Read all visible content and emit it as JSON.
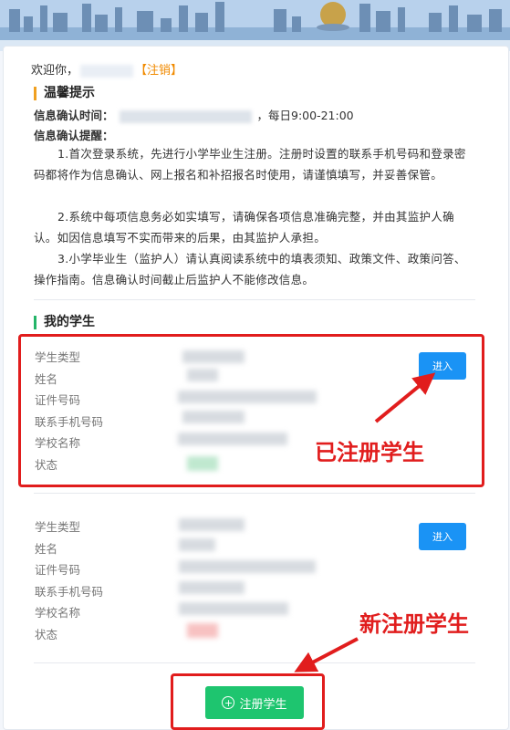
{
  "welcome": {
    "prefix": "欢迎你，",
    "logout_open": "【",
    "logout": "注销",
    "logout_close": "】"
  },
  "tips": {
    "title": "温馨提示",
    "time_label": "信息确认时间：",
    "time_suffix": "，每日9:00-21:00",
    "remind_label": "信息确认提醒：",
    "items": [
      "1.首次登录系统，先进行小学毕业生注册。注册时设置的联系手机号码和登录密码都将作为信息确认、网上报名和补招报名时使用，请谨慎填写，并妥善保管。",
      "2.系统中每项信息务必如实填写，请确保各项信息准确完整，并由其监护人确认。如因信息填写不实而带来的后果，由其监护人承担。",
      "3.小学毕业生（监护人）请认真阅读系统中的填表须知、政策文件、政策问答、操作指南。信息确认时间截止后监护人不能修改信息。"
    ]
  },
  "students": {
    "title": "我的学生",
    "field_labels": [
      "学生类型",
      "姓名",
      "证件号码",
      "联系手机号码",
      "学校名称",
      "状态"
    ],
    "enter_label": "进入",
    "status_colors": [
      "#bfe8cf",
      "#f7c1c1"
    ]
  },
  "annotations": {
    "registered": "已注册学生",
    "new_register": "新注册学生",
    "color": "#e11d1d"
  },
  "register_button": {
    "label": "注册学生",
    "icon": "plus-circle-icon"
  }
}
